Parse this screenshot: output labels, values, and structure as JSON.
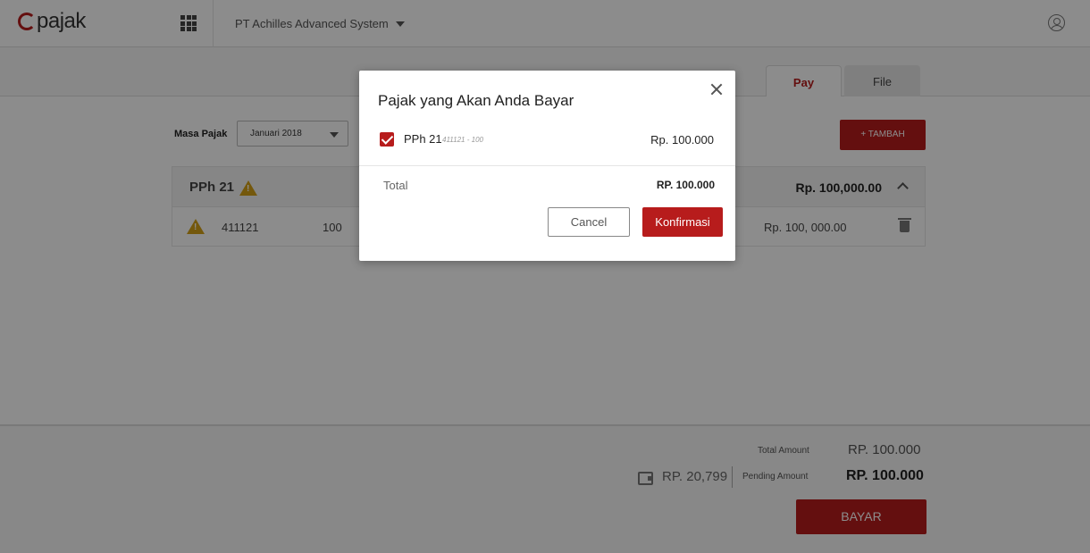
{
  "header": {
    "logo_text": "pajak",
    "company": "PT Achilles Advanced System",
    "icons": {
      "apps": "grid-icon",
      "user": "user-icon"
    }
  },
  "tabs": [
    {
      "label": "Pay",
      "active": true
    },
    {
      "label": "File",
      "active": false
    }
  ],
  "filters": {
    "masa_label": "Masa Pajak",
    "masa_value": "Januari 2018",
    "add_label": "+ TAMBAH"
  },
  "group": {
    "title": "PPh 21",
    "amount": "Rp. 100,000.00",
    "rows": [
      {
        "code": "411121",
        "sub": "100",
        "amount": "Rp. 100, 000.00"
      }
    ]
  },
  "footer": {
    "total_label": "Total Amount",
    "total_value": "RP. 100.000",
    "balance": "RP. 20,799",
    "pending_label": "Pending Amount",
    "pending_value": "RP. 100.000",
    "pay_label": "BAYAR"
  },
  "modal": {
    "title": "Pajak yang Akan Anda Bayar",
    "item": {
      "name": "PPh 21",
      "code": "411121 - 100",
      "amount": "Rp. 100.000",
      "checked": true
    },
    "total_label": "Total",
    "total_value": "RP. 100.000",
    "cancel_label": "Cancel",
    "confirm_label": "Konfirmasi"
  },
  "colors": {
    "accent": "#b71c1c",
    "warning": "#d4a017"
  }
}
